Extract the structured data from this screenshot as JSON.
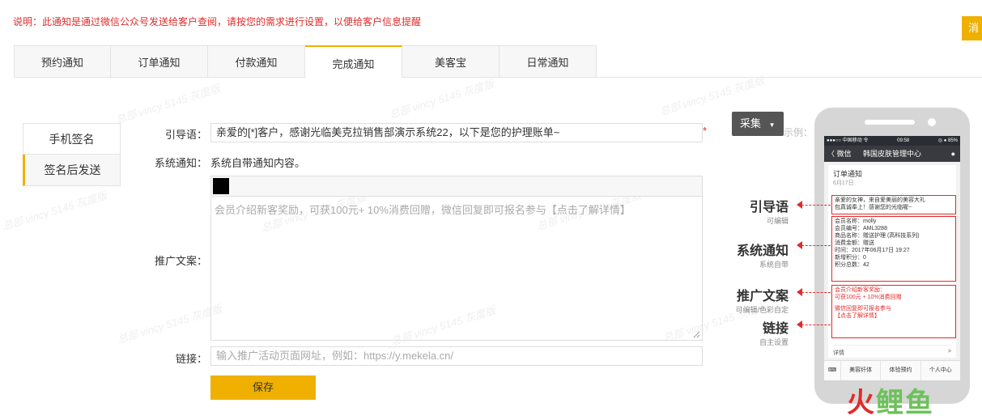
{
  "notice": "说明：此通知是通过微信公众号发送给客户查阅，请按您的需求进行设置，以便给客户信息提醒",
  "corner_button": "消",
  "tabs": [
    {
      "label": "预约通知",
      "active": false
    },
    {
      "label": "订单通知",
      "active": false
    },
    {
      "label": "付款通知",
      "active": false
    },
    {
      "label": "完成通知",
      "active": true
    },
    {
      "label": "美客宝",
      "active": false
    },
    {
      "label": "日常通知",
      "active": false
    }
  ],
  "watermark": "总部 vincy 5145 灰度版",
  "side_nav": [
    {
      "label": "手机签名",
      "active": false
    },
    {
      "label": "签名后发送",
      "active": true
    }
  ],
  "form": {
    "intro_label": "引导语：",
    "intro_value": "亲爱的[*]客户，感谢光临美克拉销售部演示系统22，以下是您的护理账单~",
    "required_mark": "*",
    "system_label": "系统通知：",
    "system_value": "系统自带通知内容。",
    "promo_label": "推广文案：",
    "promo_placeholder": "会员介绍新客奖励，可获100元+ 10%消费回赠，微信回复即可报名参与【点击了解详情】",
    "link_label": "链接：",
    "link_placeholder": "输入推广活动页面网址，例如：https://y.mekela.cn/",
    "save_label": "保存"
  },
  "sample": {
    "collect_label": "采集",
    "example_text": "示例：",
    "labels": [
      {
        "big": "引导语",
        "small": "可编辑"
      },
      {
        "big": "系统通知",
        "small": "系统自带"
      },
      {
        "big": "推广文案",
        "small": "可编辑/色彩自定"
      },
      {
        "big": "链接",
        "small": "自主设置"
      }
    ],
    "phone": {
      "status_left": "●●●○○ 中国移动 令",
      "status_time": "09:58",
      "status_right": "◎ ● 85%",
      "back": "〈 微信",
      "title": "韩国皮肤管理中心",
      "card_title": "订单通知",
      "card_date": "6月17日",
      "intro_lines": [
        "亲爱的女神，来自爱美丽的美容大礼",
        "包真诚奉上！感谢您的光临喔~"
      ],
      "info_lines": [
        "会员名称：molly",
        "会员编号：AML3288",
        "商品名称：赠送护理 (高科技系列)",
        "消费金额：赠送",
        "时间：2017年06月17日 19:27",
        "新增积分：0",
        "积分总数：42"
      ],
      "promo_lines": [
        "会员介绍新客奖励：",
        "可获100元 + 10%消费回赠",
        "",
        "微信回复即可报名参与",
        "【点击了解详情】"
      ],
      "detail": "详情",
      "detail_arrow": ">",
      "menu": [
        "美容纤体",
        "体验预约",
        "个人中心"
      ]
    },
    "logo_a": "火",
    "logo_b": "鲤鱼"
  },
  "colors": {
    "accent": "#f0b000",
    "alert": "#e02b2b",
    "border": "#e3e3e3"
  }
}
